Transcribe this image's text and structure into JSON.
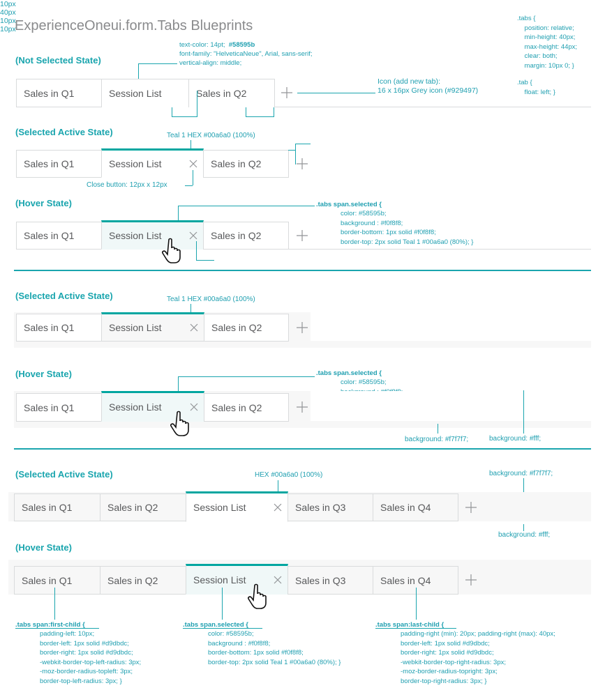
{
  "title": "ExperienceOneui.form.Tabs Blueprints",
  "colors": {
    "teal": "#00a6a0",
    "text": "#58595b",
    "border": "#d9dbdc",
    "selected_bg": "#f0f8f8",
    "bar_bg": "#f7f7f7",
    "icon_grey": "#929497"
  },
  "icons": {
    "add_tab": "plus-icon",
    "close": "close-icon",
    "cursor": "hand-cursor-icon"
  },
  "tabs": {
    "q1": "Sales in Q1",
    "q2": "Sales in Q2",
    "q3": "Sales in Q3",
    "q4": "Sales in Q4",
    "session": "Session List"
  },
  "states": {
    "not_selected": "(Not Selected State)",
    "selected_active": "(Selected Active State)",
    "hover": "(Hover State)"
  },
  "notes": {
    "text_line1": "text-color: 14pt;",
    "text_color_hex": "#58595b",
    "text_line2": "font-family: \"HelveticaNeue\", Arial, sans-serif;",
    "text_line3": "vertical-align: middle;",
    "icon_line1": "Icon (add new tab):",
    "icon_line2": "16 x 16px Grey icon (#929497)",
    "tabs_css": ".tabs {\n    position: relative;\n    min-height: 40px;\n    max-height: 44px;\n    clear: both;\n    margin: 10px 0; }",
    "tab_css": ".tab {\n    float: left; }",
    "dim_10px": "10px",
    "dim_40px": "40px",
    "teal_hex": "Teal 1 HEX #00a6a0 (100%)",
    "hex_only": "HEX #00a6a0 (100%)",
    "close_button": "Close button: 12px x 12px",
    "selected_css_title": ".tabs span.selected {",
    "selected_css_body": "color: #58595b;\nbackground : #f0f8f8;\nborder-bottom: 1px solid #f0f8f8;\nborder-top: 2px solid Teal 1 #00a6a0 (80%); }",
    "bg_f7": "background: #f7f7f7;",
    "bg_fff": "background: #fff;",
    "first_child_title": ".tabs span:first-child {",
    "first_child_body": "padding-left: 10px;\nborder-left: 1px solid #d9dbdc;\nborder-right: 1px solid #d9dbdc;\n-webkit-border-top-left-radius: 3px;\n-moz-border-radius-topleft: 3px;\nborder-top-left-radius: 3px; }",
    "last_child_title": ".tabs span:last-child {",
    "last_child_body": "padding-right (min): 20px; padding-right (max): 40px;\nborder-left: 1px solid #d9dbdc;\nborder-right: 1px solid #d9dbdc;\n-webkit-border-top-right-radius: 3px;\n-moz-border-radius-topright: 3px;\nborder-top-right-radius: 3px; }"
  }
}
